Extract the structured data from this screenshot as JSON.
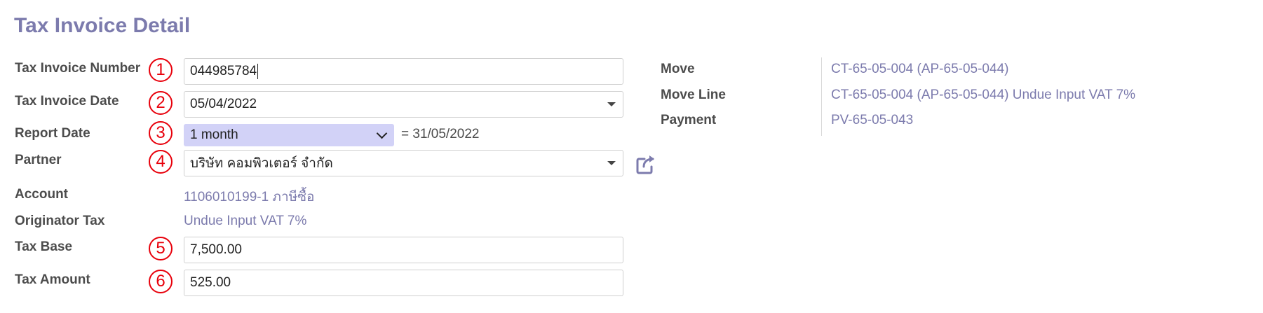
{
  "page_title": "Tax Invoice Detail",
  "fields": {
    "tax_invoice_number": {
      "label": "Tax Invoice Number",
      "value": "044985784",
      "marker": "1"
    },
    "tax_invoice_date": {
      "label": "Tax Invoice Date",
      "value": "05/04/2022",
      "marker": "2"
    },
    "report_date": {
      "label": "Report Date",
      "period": "1 month",
      "result": "= 31/05/2022",
      "marker": "3"
    },
    "partner": {
      "label": "Partner",
      "value": "บริษัท คอมพิวเตอร์ จำกัด",
      "marker": "4"
    },
    "account": {
      "label": "Account",
      "value": "1106010199-1 ภาษีซื้อ"
    },
    "originator_tax": {
      "label": "Originator Tax",
      "value": "Undue Input VAT 7%"
    },
    "tax_base": {
      "label": "Tax Base",
      "value": "7,500.00",
      "marker": "5"
    },
    "tax_amount": {
      "label": "Tax Amount",
      "value": "525.00",
      "marker": "6"
    }
  },
  "right_panel": {
    "move": {
      "label": "Move",
      "value": "CT-65-05-004 (AP-65-05-044)"
    },
    "move_line": {
      "label": "Move Line",
      "value": "CT-65-05-004 (AP-65-05-044) Undue Input VAT 7%"
    },
    "payment": {
      "label": "Payment",
      "value": "PV-65-05-043"
    }
  },
  "icons": {
    "partner_external": "external-link-icon"
  },
  "colors": {
    "title": "#7c7bad",
    "link": "#7c7bad",
    "marker": "#e8000b",
    "period_bg": "#d2d2f7"
  }
}
